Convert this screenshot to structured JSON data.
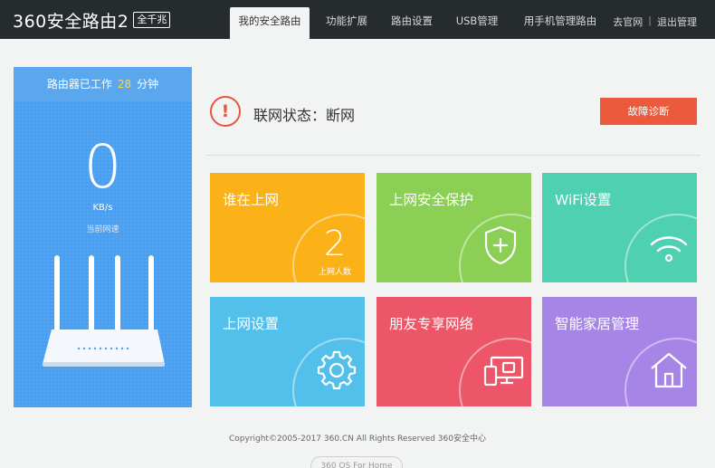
{
  "header": {
    "logo": "360安全路由2",
    "logo_badge": "全千兆",
    "nav": [
      {
        "label": "我的安全路由",
        "active": true
      },
      {
        "label": "功能扩展",
        "active": false
      },
      {
        "label": "路由设置",
        "active": false
      },
      {
        "label": "USB管理",
        "active": false
      },
      {
        "label": "用手机管理路由",
        "active": false
      }
    ],
    "links": {
      "official": "去官网",
      "separator": "|",
      "logout": "退出管理"
    }
  },
  "left_panel": {
    "uptime_prefix": "路由器已工作",
    "uptime_value": "28",
    "uptime_unit": "分钟",
    "speed_value": "0",
    "speed_unit": "KB/s",
    "speed_label": "当前网速"
  },
  "status": {
    "alert_glyph": "!",
    "text": "联网状态：断网",
    "diagnose_button": "故障诊断"
  },
  "tiles": [
    {
      "title": "谁在上网",
      "value": "2",
      "sub_label": "上网人数",
      "color": "#fbb218",
      "icon": "online-count"
    },
    {
      "title": "上网安全保护",
      "color": "#8ccf55",
      "icon": "shield-plus-icon"
    },
    {
      "title": "WiFi设置",
      "color": "#4fd0b0",
      "icon": "wifi-icon"
    },
    {
      "title": "上网设置",
      "color": "#52c0ea",
      "icon": "gear-icon"
    },
    {
      "title": "朋友专享网络",
      "color": "#ec5668",
      "icon": "devices-icon"
    },
    {
      "title": "智能家居管理",
      "color": "#a685e6",
      "icon": "home-icon"
    }
  ],
  "footer": {
    "copyright": "Copyright©2005-2017 360.CN All Rights Reserved 360安全中心",
    "os_badge": "360 OS For Home"
  },
  "colors": {
    "header_bg": "#262b2e",
    "panel_blue": "#4b9ff0",
    "accent_red": "#ea5a3b",
    "uptime_highlight": "#ffd34f"
  }
}
